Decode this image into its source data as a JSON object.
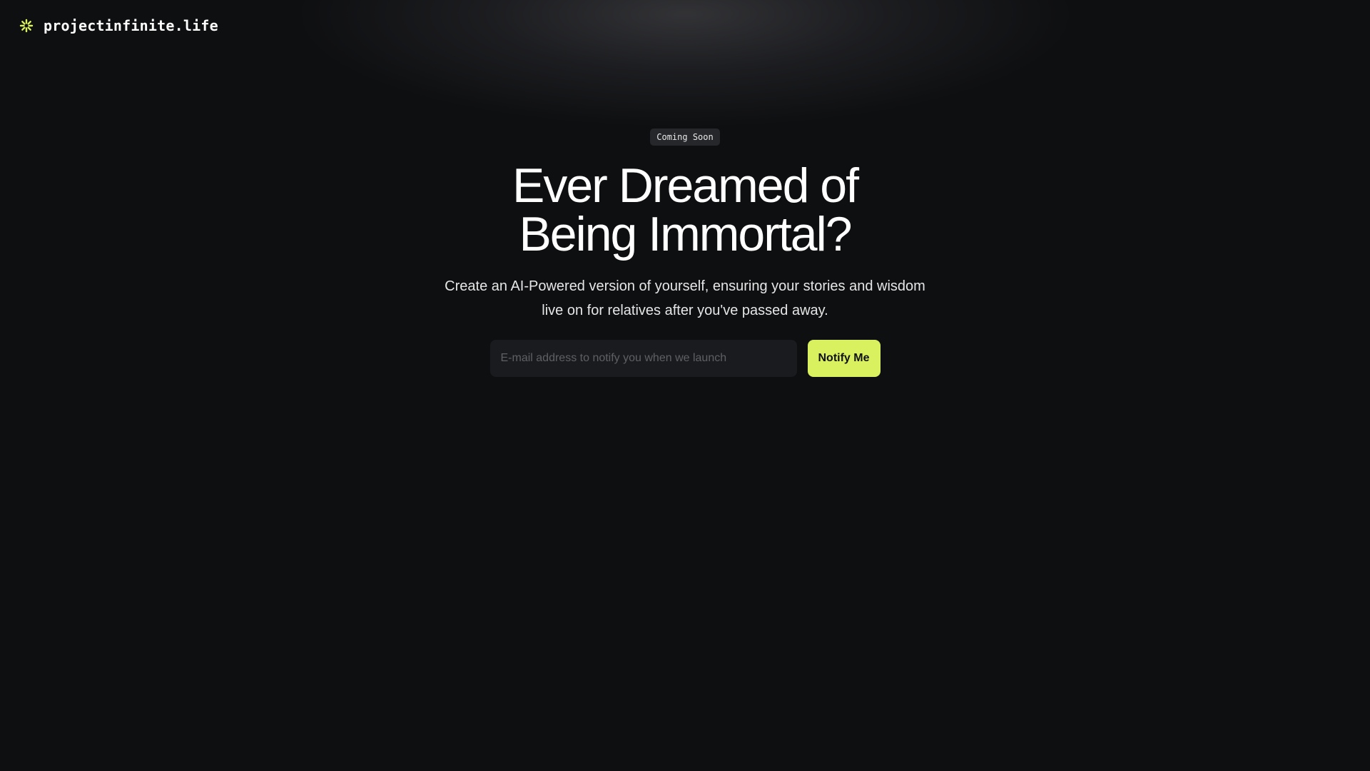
{
  "header": {
    "brand_icon": "asterisk-logo-icon",
    "brand_name": "projectinfinite.life",
    "accent_color": "#d9f15e"
  },
  "hero": {
    "badge": "Coming Soon",
    "headline_line1": "Ever Dreamed of",
    "headline_line2": "Being Immortal?",
    "subtitle": "Create an AI-Powered version of yourself, ensuring your stories and wisdom live on for relatives after you've passed away."
  },
  "signup": {
    "email_value": "",
    "email_placeholder": "E-mail address to notify you when we launch",
    "button_label": "Notify Me",
    "button_color": "#d9f15e"
  }
}
